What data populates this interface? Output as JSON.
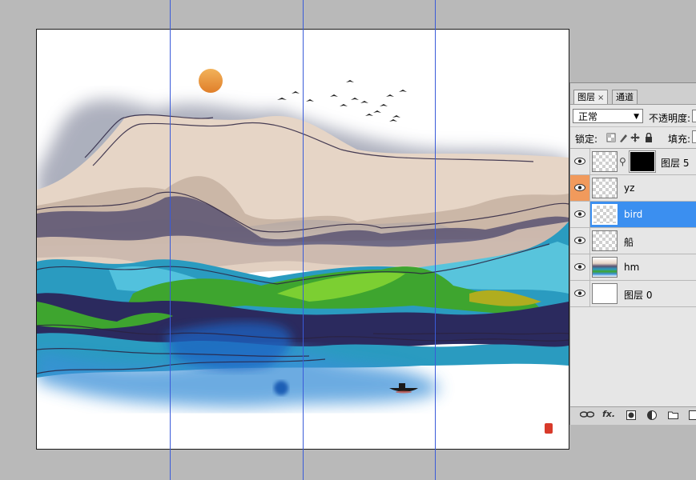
{
  "canvas": {
    "background": "#ffffff",
    "sun_color": "#e9903a",
    "seal_color": "#d83a2a"
  },
  "guides": {
    "color": "#3a5bd9",
    "count": 3
  },
  "layers_panel": {
    "tabs": [
      {
        "label": "图层",
        "close": "×",
        "active": true
      },
      {
        "label": "通道",
        "active": false
      }
    ],
    "blend_mode": "正常",
    "opacity_label": "不透明度:",
    "lock_label": "锁定:",
    "fill_label": "填充:",
    "layers": [
      {
        "name": "图层 5",
        "visible": true,
        "thumb": "transparent",
        "has_mask": true,
        "selected": false,
        "eye_highlight": false
      },
      {
        "name": "yz",
        "visible": true,
        "thumb": "transparent",
        "has_mask": false,
        "selected": false,
        "eye_highlight": true
      },
      {
        "name": "bird",
        "visible": true,
        "thumb": "transparent",
        "has_mask": false,
        "selected": true,
        "eye_highlight": false
      },
      {
        "name": "船",
        "visible": true,
        "thumb": "transparent",
        "has_mask": false,
        "selected": false,
        "eye_highlight": false
      },
      {
        "name": "hm",
        "visible": true,
        "thumb": "image",
        "has_mask": false,
        "selected": false,
        "eye_highlight": false
      },
      {
        "name": "图层 0",
        "visible": true,
        "thumb": "white",
        "has_mask": false,
        "selected": false,
        "eye_highlight": false
      }
    ],
    "footer_icons": [
      "link-icon",
      "fx-icon",
      "mask-icon",
      "adjustment-icon",
      "folder-icon",
      "new-layer-icon"
    ]
  }
}
